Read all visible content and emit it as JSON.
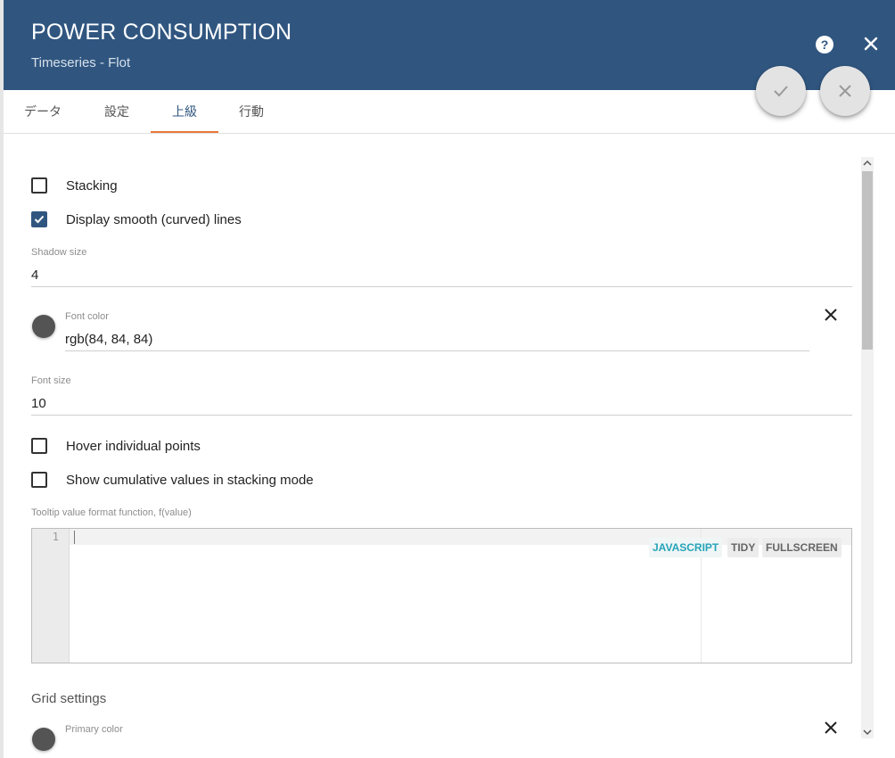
{
  "dialog": {
    "title": "POWER CONSUMPTION",
    "subtitle": "Timeseries - Flot"
  },
  "header_actions": {
    "help_icon": "help-circle-icon",
    "close_icon": "close-icon",
    "accept_icon": "check-icon",
    "cancel_icon": "close-icon"
  },
  "tabs": [
    {
      "label": "データ",
      "active": false
    },
    {
      "label": "設定",
      "active": false
    },
    {
      "label": "上級",
      "active": true
    },
    {
      "label": "行動",
      "active": false
    }
  ],
  "advanced": {
    "stacking": {
      "label": "Stacking",
      "checked": false
    },
    "smooth_lines": {
      "label": "Display smooth (curved) lines",
      "checked": true
    },
    "shadow_size": {
      "label": "Shadow size",
      "value": "4"
    },
    "font_color": {
      "label": "Font color",
      "value": "rgb(84, 84, 84)",
      "swatch": "#545454"
    },
    "font_size": {
      "label": "Font size",
      "value": "10"
    },
    "hover_individual": {
      "label": "Hover individual points",
      "checked": false
    },
    "show_cumulative": {
      "label": "Show cumulative values in stacking mode",
      "checked": false
    },
    "tooltip_format": {
      "label": "Tooltip value format function, f(value)",
      "line_number": "1",
      "code": "",
      "buttons": {
        "javascript": "JAVASCRIPT",
        "tidy": "TIDY",
        "fullscreen": "FULLSCREEN"
      }
    },
    "grid_settings": {
      "title": "Grid settings",
      "primary_color": {
        "label": "Primary color"
      }
    }
  },
  "colors": {
    "header_bg": "#305680",
    "active_tab_indicator": "#e8793b",
    "checkbox_checked": "#305680",
    "javascript_mode": "#25a5b8"
  }
}
